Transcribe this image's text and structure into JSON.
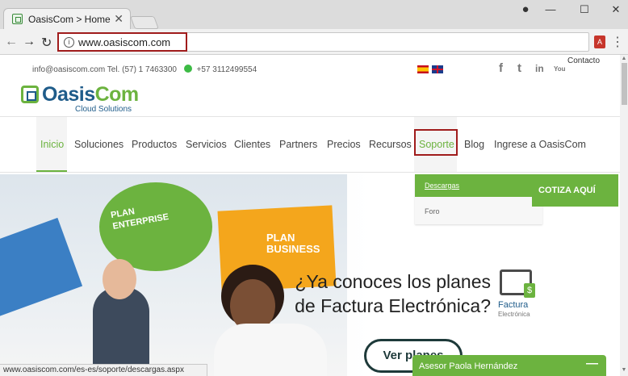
{
  "browser": {
    "tab_title": "OasisCom > Home",
    "tab_close": "✕",
    "url": "www.oasiscom.com",
    "info_icon": "i",
    "win_min": "—",
    "win_max": "☐",
    "win_close": "✕"
  },
  "topbar": {
    "email_phone": "info@oasiscom.com Tel. (57) 1 7463300",
    "whatsapp": "+57 3112499554",
    "contacto": "Contacto",
    "social": {
      "facebook": "f",
      "twitter": "t",
      "linkedin": "in",
      "youtube": "You"
    }
  },
  "logo": {
    "text_main": "Oasis",
    "text_accent": "Com",
    "subtitle": "Cloud Solutions"
  },
  "nav": {
    "items": [
      {
        "label": "Inicio"
      },
      {
        "label": "Soluciones"
      },
      {
        "label": "Productos"
      },
      {
        "label": "Servicios"
      },
      {
        "label": "Clientes"
      },
      {
        "label": "Partners"
      },
      {
        "label": "Precios"
      },
      {
        "label": "Recursos"
      },
      {
        "label": "Soporte"
      },
      {
        "label": "Blog"
      },
      {
        "label": "Ingrese a OasisCom"
      }
    ]
  },
  "dropdown": {
    "items": [
      {
        "label": "Descargas"
      },
      {
        "label": "Foro"
      }
    ]
  },
  "cotiza": "COTIZA AQUÍ",
  "hero": {
    "bubble_enterprise": "PLAN\nENTERPRISE",
    "bubble_business": "PLAN\nBUSINESS",
    "title": "¿Ya conoces los planes de Factura Electrónica?",
    "fe_label": "Factura",
    "fe_sub": "Electrónica",
    "button": "Ver planes"
  },
  "status_bar": "www.oasiscom.com/es-es/soporte/descargas.aspx",
  "chat": {
    "name": "Asesor Paola Hernández",
    "minimize": "—"
  },
  "colors": {
    "brand_green": "#6cb33f",
    "brand_blue": "#1f5c8a",
    "highlight_red": "#a01c1c"
  }
}
